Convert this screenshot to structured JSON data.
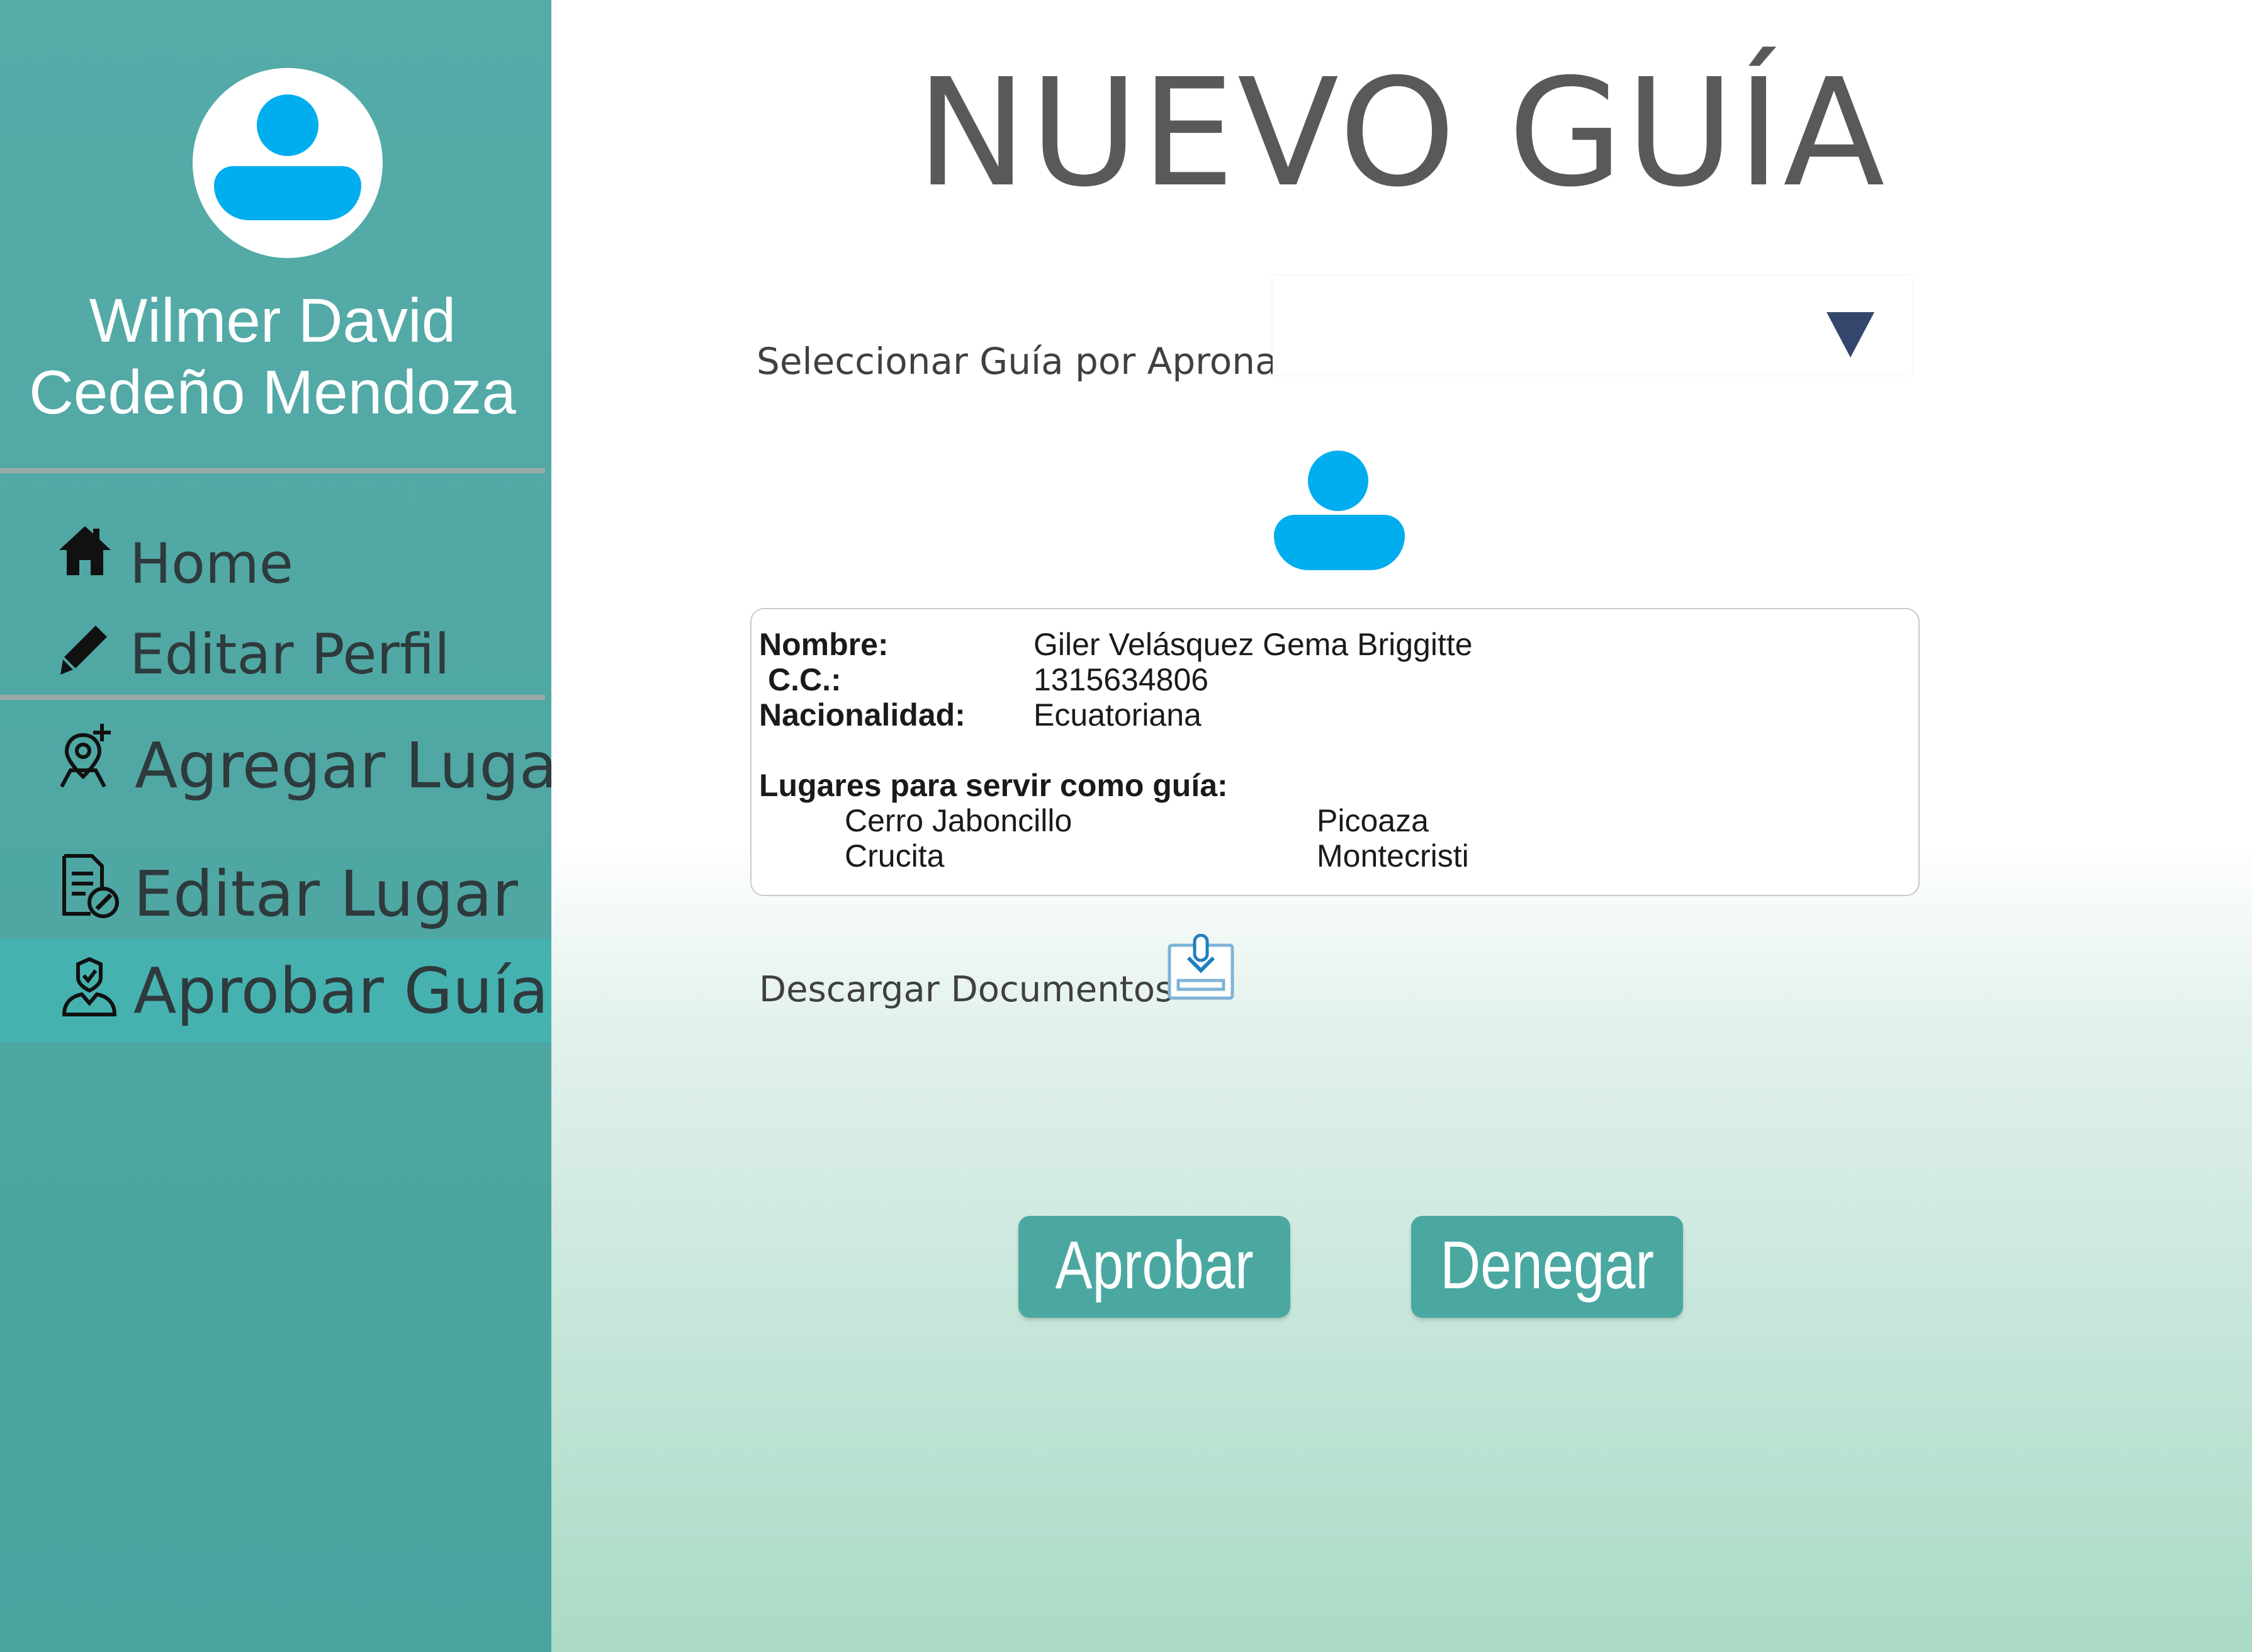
{
  "sidebar": {
    "user_name": "Wilmer David Cedeño Mendoza",
    "avatar_icon": "user-avatar-icon",
    "items": [
      {
        "label": "Home",
        "icon": "home-icon"
      },
      {
        "label": "Editar Perfil",
        "icon": "pencil-icon"
      },
      {
        "label": "Agregar Lugar",
        "icon": "add-location-icon"
      },
      {
        "label": "Editar Lugar",
        "icon": "edit-document-icon"
      },
      {
        "label": "Aprobar Guía",
        "icon": "approve-user-icon",
        "active": true
      }
    ]
  },
  "main": {
    "title": "NUEVO GUÍA",
    "select_label": "Seleccionar Guía por Apronar",
    "select_value": "",
    "guide_avatar_icon": "user-avatar-icon",
    "info": {
      "nombre_label": "Nombre:",
      "nombre": "Giler Velásquez Gema Briggitte",
      "cc_label": "C.C.:",
      "cc": "1315634806",
      "nacionalidad_label": "Nacionalidad:",
      "nacionalidad": "Ecuatoriana",
      "lugares_label": "Lugares para servir como guía:",
      "lugares": [
        "Cerro Jaboncillo",
        "Picoaza",
        "Crucita",
        "Montecristi"
      ]
    },
    "download_label": "Descargar Documentos",
    "approve_label": "Aprobar",
    "deny_label": "Denegar"
  },
  "colors": {
    "sidebar": "#4ea8a4",
    "sidebar_active": "#45b2b0",
    "accent_blue": "#00adef",
    "button": "#4aa8a1",
    "select_arrow": "#34466b"
  }
}
